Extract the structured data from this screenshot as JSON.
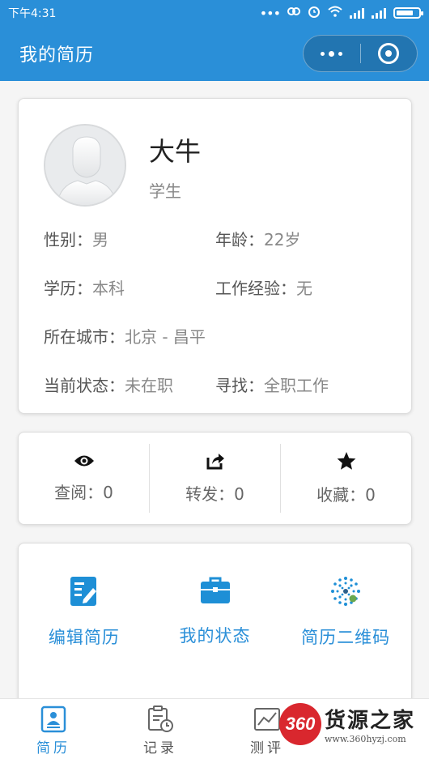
{
  "status_bar": {
    "time": "下午4:31"
  },
  "nav": {
    "title": "我的简历"
  },
  "profile": {
    "name": "大牛",
    "role": "学生",
    "gender_label": "性别：",
    "gender_value": "男",
    "age_label": "年龄：",
    "age_value": "22岁",
    "education_label": "学历：",
    "education_value": "本科",
    "experience_label": "工作经验：",
    "experience_value": "无",
    "city_label": "所在城市：",
    "city_value": "北京 - 昌平",
    "status_label": "当前状态：",
    "status_value": "未在职",
    "seeking_label": "寻找：",
    "seeking_value": "全职工作"
  },
  "stats": [
    {
      "icon": "eye-icon",
      "label": "查阅：0"
    },
    {
      "icon": "share-icon",
      "label": "转发：0"
    },
    {
      "icon": "star-icon",
      "label": "收藏：0"
    }
  ],
  "actions": [
    {
      "icon": "edit-resume-icon",
      "label": "编辑简历"
    },
    {
      "icon": "briefcase-icon",
      "label": "我的状态"
    },
    {
      "icon": "qrcode-icon",
      "label": "简历二维码"
    }
  ],
  "tabs": [
    {
      "icon": "resume-icon",
      "label": "简历",
      "active": true
    },
    {
      "icon": "record-icon",
      "label": "记录"
    },
    {
      "icon": "evaluation-icon",
      "label": "测评"
    }
  ],
  "watermark": {
    "logo": "360",
    "title": "货源之家",
    "url": "www.360hyzj.com"
  },
  "colors": {
    "primary": "#2a8fd8",
    "background": "#f5f5f5",
    "watermark_red": "#d9272e"
  }
}
